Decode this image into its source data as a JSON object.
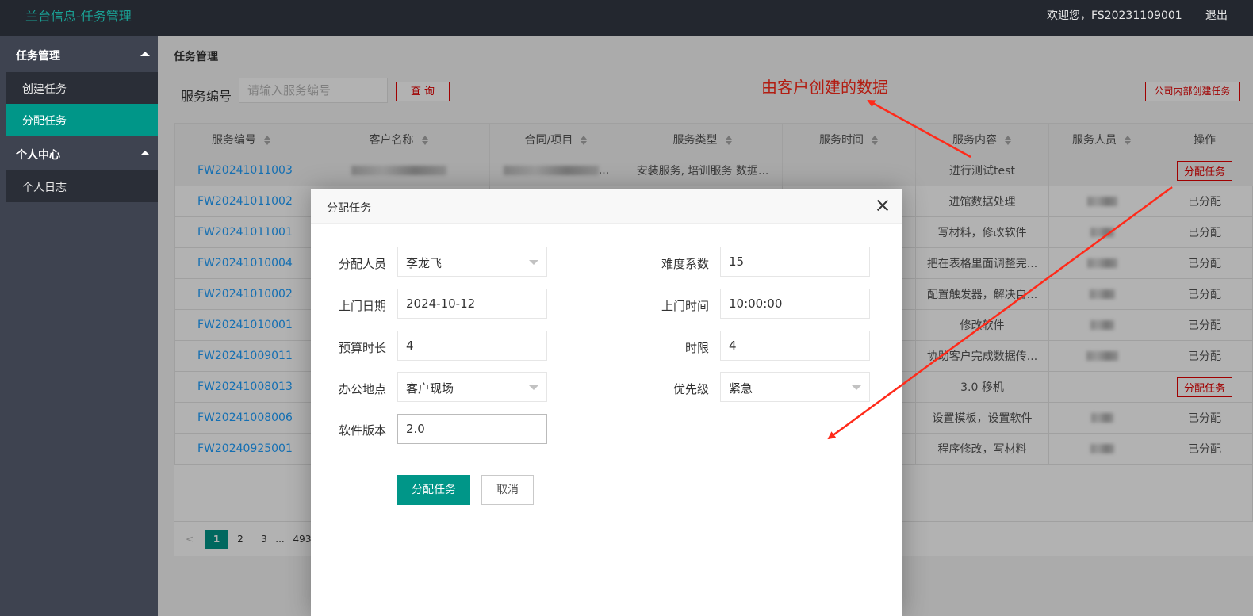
{
  "header": {
    "app_title": "兰台信息-任务管理",
    "welcome": "欢迎您，FS20231109001",
    "logout": "退出"
  },
  "sidebar": {
    "groups": [
      {
        "label": "任务管理",
        "items": [
          {
            "label": "创建任务"
          },
          {
            "label": "分配任务"
          }
        ]
      },
      {
        "label": "个人中心",
        "items": [
          {
            "label": "个人日志"
          }
        ]
      }
    ],
    "active_item": "分配任务"
  },
  "main": {
    "breadcrumb": "任务管理",
    "search": {
      "label": "服务编号",
      "placeholder": "请输入服务编号",
      "value": ""
    },
    "query_button": "查 询",
    "internal_button": "公司内部创建任务",
    "annotation": "由客户创建的数据",
    "table": {
      "columns": [
        "服务编号",
        "客户名称",
        "合同/项目",
        "服务类型",
        "服务时间",
        "服务内容",
        "服务人员",
        "操作"
      ],
      "rows": [
        {
          "code": "FW20241011003",
          "contract_suffix": "...",
          "type": "安装服务, 培训服务 数据...",
          "content": "进行测试test",
          "action": "分配任务"
        },
        {
          "code": "FW20241011002",
          "content": "进馆数据处理",
          "action": "已分配"
        },
        {
          "code": "FW20241011001",
          "content": "写材料，修改软件",
          "action": "已分配"
        },
        {
          "code": "FW20241010004",
          "content": "把在表格里面调整完...",
          "action": "已分配"
        },
        {
          "code": "FW20241010002",
          "content": "配置触发器，解决自...",
          "action": "已分配"
        },
        {
          "code": "FW20241010001",
          "content": "修改软件",
          "action": "已分配"
        },
        {
          "code": "FW20241009011",
          "content": "协助客户完成数据传...",
          "action": "已分配"
        },
        {
          "code": "FW20241008013",
          "content": "3.0 移机",
          "action": "分配任务"
        },
        {
          "code": "FW20241008006",
          "content": "设置模板，设置软件",
          "action": "已分配"
        },
        {
          "code": "FW20240925001",
          "content": "程序修改，写材料",
          "action": "已分配"
        }
      ]
    },
    "pager": {
      "prev": "<",
      "pages": [
        "1",
        "2",
        "3",
        "...",
        "493"
      ],
      "current": "1"
    }
  },
  "dialog": {
    "title": "分配任务",
    "fields": {
      "assignee": {
        "label": "分配人员",
        "value": "李龙飞"
      },
      "difficulty": {
        "label": "难度系数",
        "value": "15"
      },
      "visit_date": {
        "label": "上门日期",
        "value": "2024-10-12"
      },
      "visit_time": {
        "label": "上门时间",
        "value": "10:00:00"
      },
      "budget_hours": {
        "label": "预算时长",
        "value": "4"
      },
      "time_limit": {
        "label": "时限",
        "value": "4"
      },
      "office_location": {
        "label": "办公地点",
        "value": "客户现场"
      },
      "priority": {
        "label": "优先级",
        "value": "紧急"
      },
      "software_version": {
        "label": "软件版本",
        "value": "2.0"
      }
    },
    "submit": "分配任务",
    "cancel": "取消"
  },
  "colors": {
    "accent": "#009688",
    "topbar": "#23272f",
    "sidebar": "#3e4350",
    "link": "#1e9fff",
    "danger": "#e60000",
    "annotation": "#ff2a1a"
  }
}
